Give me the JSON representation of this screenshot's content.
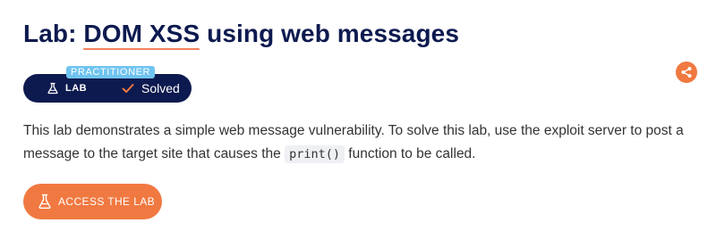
{
  "lab": {
    "title_prefix": "Lab: ",
    "title_highlight": "DOM XSS",
    "title_suffix": " using web messages",
    "level": "PRACTITIONER",
    "badge_label": "LAB",
    "status": "Solved",
    "description_part1": "This lab demonstrates a simple web message vulnerability. To solve this lab, use the exploit server to post a message to the target site that causes the ",
    "code": "print()",
    "description_part2": " function to be called.",
    "access_button": "ACCESS THE LAB"
  },
  "icons": {
    "share": "share-icon",
    "flask": "flask-icon",
    "check": "check-icon"
  },
  "colors": {
    "navy": "#0d1a4f",
    "accent": "#f07941",
    "level_badge": "#6fc4f0"
  }
}
